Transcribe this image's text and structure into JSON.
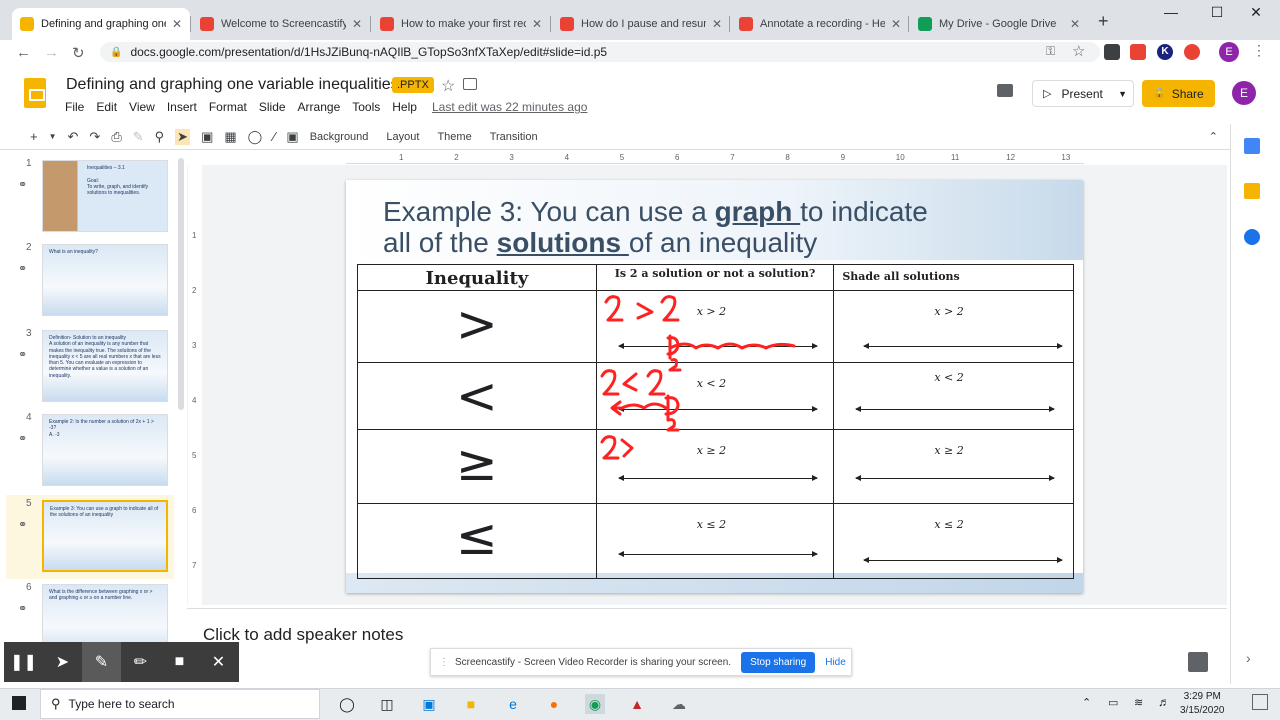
{
  "browser": {
    "tabs": [
      {
        "title": "Defining and graphing one v",
        "color": "#f4b400",
        "active": true
      },
      {
        "title": "Welcome to Screencastify! |",
        "color": "#ea4335",
        "active": false
      },
      {
        "title": "How to make your first reco",
        "color": "#ea4335",
        "active": false
      },
      {
        "title": "How do I pause and resume",
        "color": "#ea4335",
        "active": false
      },
      {
        "title": "Annotate a recording - Help",
        "color": "#ea4335",
        "active": false
      },
      {
        "title": "My Drive - Google Drive",
        "color": "#0f9d58",
        "active": false
      }
    ],
    "url": "docs.google.com/presentation/d/1HsJZiBunq-nAQIlB_GTopSo3nfXTaXep/edit#slide=id.p5",
    "new_tab": "+",
    "ext_letters": [
      "K",
      "E"
    ],
    "profile_initial": "E"
  },
  "slides_app": {
    "title": "Defining and graphing one variable inequalities",
    "badge": ".PPTX",
    "menu": [
      "File",
      "Edit",
      "View",
      "Insert",
      "Format",
      "Slide",
      "Arrange",
      "Tools",
      "Help"
    ],
    "last_edit": "Last edit was 22 minutes ago",
    "present_label": "Present",
    "share_label": "Share",
    "avatar_initial": "E",
    "toolbar_text": [
      "Background",
      "Layout",
      "Theme",
      "Transition"
    ]
  },
  "filmstrip": [
    {
      "num": "1",
      "text": "Inequalities – 3.1\n\nGoal:\nTo write, graph, and identify solutions to inequalities."
    },
    {
      "num": "2",
      "text": "What is an inequality?"
    },
    {
      "num": "3",
      "text": "Definition- Solution to an inequality\nA solution of an inequality is any number that makes the inequality true. The solutions of the inequality x < 5 are all real numbers x that are less than 5. You can evaluate an expression to determine whether a value is a solution of an inequality."
    },
    {
      "num": "4",
      "text": "Example 2: Is the number a solution of 2x + 1 > -3?\nA. -3"
    },
    {
      "num": "5",
      "text": "Example 3: You can use a graph to indicate all of the solutions of an inequality"
    },
    {
      "num": "6",
      "text": "What is the difference between graphing x or > and graphing ≤ or ≥ on a number line."
    }
  ],
  "ruler_ticks": [
    "1",
    "2",
    "3",
    "4",
    "5",
    "6",
    "7",
    "8",
    "9",
    "10",
    "11",
    "12",
    "13"
  ],
  "vruler_ticks": [
    "1",
    "2",
    "3",
    "4",
    "5",
    "6",
    "7"
  ],
  "slide": {
    "title_1": "Example 3: You can use a ",
    "title_graph": "graph ",
    "title_2": "to indicate",
    "title_3": "all of the ",
    "title_solutions": "solutions ",
    "title_4": "of an inequality",
    "headers": [
      "Inequality",
      "Is 2 a solution or not a solution?",
      "Shade all solutions"
    ],
    "rows": [
      {
        "symbol": ">",
        "expr": "x > 2"
      },
      {
        "symbol": "<",
        "expr": "x < 2"
      },
      {
        "symbol": "≥",
        "expr": "x ≥ 2"
      },
      {
        "symbol": "≤",
        "expr": "x ≤ 2"
      }
    ],
    "ink_color": "#ff2222"
  },
  "speaker_notes": "Click to add speaker notes",
  "screencastify": {
    "share_text": "Screencastify - Screen Video Recorder is sharing your screen.",
    "stop_label": "Stop sharing",
    "hide_label": "Hide"
  },
  "taskbar": {
    "search_placeholder": "Type here to search",
    "time": "3:29 PM",
    "date": "3/15/2020"
  }
}
